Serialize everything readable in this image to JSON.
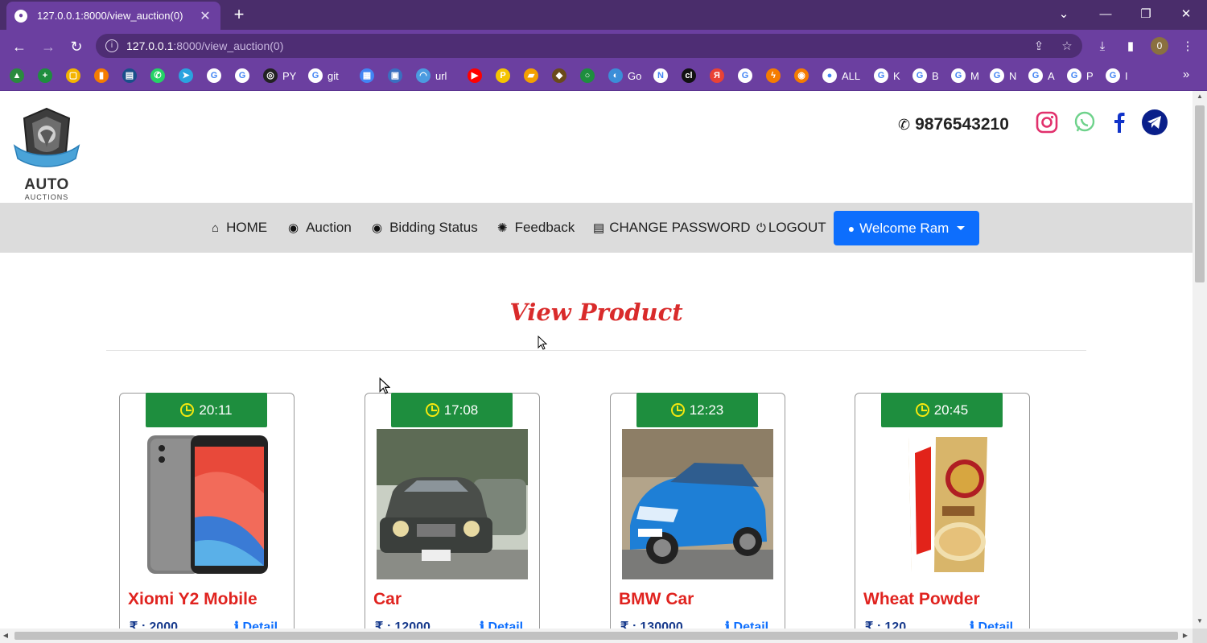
{
  "browser": {
    "tab_title": "127.0.0.1:8000/view_auction(0)",
    "url_host": "127.0.0.1",
    "url_rest": ":8000/view_auction(0)",
    "profile_initial": "0",
    "bookmarks": [
      {
        "icon": "drive-icon",
        "label": "",
        "color": "#2a8a3e"
      },
      {
        "icon": "sheets-plus-icon",
        "label": "",
        "color": "#1e8e3e"
      },
      {
        "icon": "slides-icon",
        "label": "",
        "color": "#f4b400"
      },
      {
        "icon": "analytics-icon",
        "label": "",
        "color": "#f57c00"
      },
      {
        "icon": "ieee-icon",
        "label": "",
        "color": "#1a4f8a"
      },
      {
        "icon": "whatsapp-icon",
        "label": "",
        "color": "#25d366"
      },
      {
        "icon": "telegram-icon",
        "label": "",
        "color": "#2aa3df"
      },
      {
        "icon": "google-icon",
        "label": "",
        "color": "#ffffff"
      },
      {
        "icon": "google-icon",
        "label": "",
        "color": "#ffffff"
      },
      {
        "icon": "github-icon",
        "label": "PY",
        "color": "#222222"
      },
      {
        "icon": "google-icon",
        "label": "git",
        "color": "#ffffff"
      },
      {
        "icon": "calendar-icon",
        "label": "",
        "color": "#4285f4"
      },
      {
        "icon": "bus-icon",
        "label": "",
        "color": "#3a6fc0"
      },
      {
        "icon": "wifi-icon",
        "label": "url",
        "color": "#4b9be0"
      },
      {
        "icon": "youtube-icon",
        "label": "",
        "color": "#ff0000"
      },
      {
        "icon": "p-icon",
        "label": "",
        "color": "#f5c400"
      },
      {
        "icon": "camera-icon",
        "label": "",
        "color": "#f3a000"
      },
      {
        "icon": "helmet-icon",
        "label": "",
        "color": "#6a4a1a"
      },
      {
        "icon": "ring-icon",
        "label": "",
        "color": "#1e8e3e"
      },
      {
        "icon": "edge-icon",
        "label": "Go",
        "color": "#3b8ed8"
      },
      {
        "icon": "notion-icon",
        "label": "",
        "color": "#ffffff"
      },
      {
        "icon": "cl-icon",
        "label": "",
        "color": "#111111"
      },
      {
        "icon": "yandex-icon",
        "label": "",
        "color": "#e94235"
      },
      {
        "icon": "google-icon",
        "label": "",
        "color": "#ffffff"
      },
      {
        "icon": "bolt-icon",
        "label": "",
        "color": "#f57c00"
      },
      {
        "icon": "eye-icon",
        "label": "",
        "color": "#f57c00"
      },
      {
        "icon": "globe-icon",
        "label": "ALL",
        "color": "#ffffff"
      },
      {
        "icon": "google-icon",
        "label": "K",
        "color": "#ffffff"
      },
      {
        "icon": "google-icon",
        "label": "B",
        "color": "#ffffff"
      },
      {
        "icon": "google-icon",
        "label": "M",
        "color": "#ffffff"
      },
      {
        "icon": "google-icon",
        "label": "N",
        "color": "#ffffff"
      },
      {
        "icon": "google-icon",
        "label": "A",
        "color": "#ffffff"
      },
      {
        "icon": "google-icon",
        "label": "P",
        "color": "#ffffff"
      },
      {
        "icon": "google-icon",
        "label": "I",
        "color": "#ffffff"
      }
    ]
  },
  "header": {
    "logo_title": "AUTO",
    "logo_subtitle": "AUCTIONS",
    "phone": "9876543210",
    "social": [
      "instagram-icon",
      "whatsapp-icon",
      "facebook-icon",
      "telegram-icon"
    ]
  },
  "nav": {
    "home": "HOME",
    "auction": "Auction",
    "bidding_status": "Bidding Status",
    "feedback": "Feedback",
    "change_password": "CHANGE PASSWORD",
    "logout": "LOGOUT",
    "welcome": "Welcome Ram"
  },
  "page": {
    "title": "View Product"
  },
  "products": [
    {
      "timer": "20:11",
      "name": "Xiomi Y2 Mobile",
      "price": "₹ : 2000",
      "detail": "Detail",
      "image": "phone"
    },
    {
      "timer": "17:08",
      "name": "Car",
      "price": "₹ : 12000",
      "detail": "Detail",
      "image": "vintage-car"
    },
    {
      "timer": "12:23",
      "name": "BMW Car",
      "price": "₹ : 130000",
      "detail": "Detail",
      "image": "bmw"
    },
    {
      "timer": "20:45",
      "name": "Wheat Powder",
      "price": "₹ : 120",
      "detail": "Detail",
      "image": "flour"
    }
  ],
  "colors": {
    "chrome_dark": "#4a2d6b",
    "chrome": "#6b3fa0",
    "title_red": "#d92b2b",
    "timer_green": "#1e8e3e",
    "welcome_blue": "#0d6efd"
  }
}
